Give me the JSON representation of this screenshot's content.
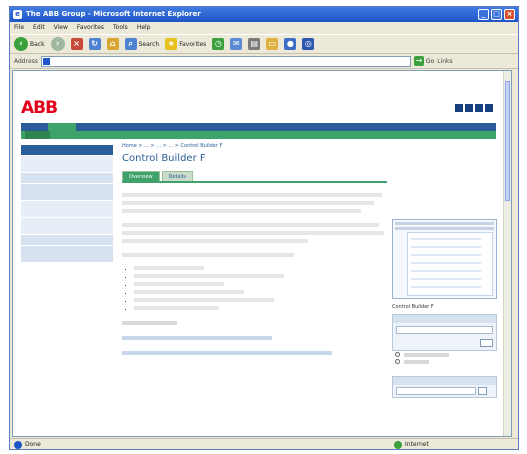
{
  "window": {
    "title": "The ABB Group - Microsoft Internet Explorer",
    "buttons": [
      "_",
      "□",
      "×"
    ]
  },
  "menubar": [
    "File",
    "Edit",
    "View",
    "Favorites",
    "Tools",
    "Help"
  ],
  "toolbar": {
    "back": "Back",
    "search": "Search",
    "favorites": "Favorites"
  },
  "address": {
    "label": "Address",
    "go": "Go",
    "links": "Links"
  },
  "site": {
    "logo": "ABB",
    "breadcrumb": "Home > ... > ... > ... > Control Builder F",
    "page_title": "Control Builder F",
    "tabs": [
      "Overview",
      "Details"
    ],
    "bullets_count": 6,
    "right_box_title": "Control Builder F",
    "radio_1": "",
    "radio_2": ""
  },
  "statusbar": {
    "left": "Done",
    "zone": "Internet"
  },
  "colors": {
    "abb_red": "#e2001a",
    "nav_blue": "#2a5d9a",
    "nav_green": "#3ea26a"
  }
}
